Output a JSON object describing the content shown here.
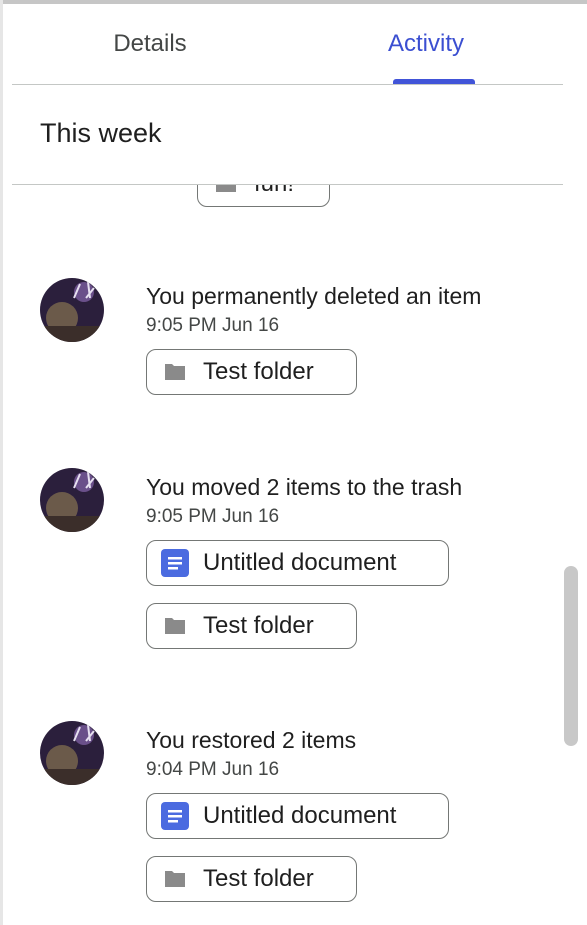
{
  "tabs": [
    {
      "label": "Details",
      "selected": false
    },
    {
      "label": "Activity",
      "selected": true
    }
  ],
  "accent_color": "#3b4fd1",
  "section": {
    "title": "This week"
  },
  "partial_item": {
    "label": "fun!",
    "icon": "folder-icon"
  },
  "entries": [
    {
      "title": "You permanently deleted an item",
      "time": "9:05 PM Jun 16",
      "items": [
        {
          "label": "Test folder",
          "icon": "folder-icon"
        }
      ]
    },
    {
      "title": "You moved 2 items to the trash",
      "time": "9:05 PM Jun 16",
      "items": [
        {
          "label": "Untitled document",
          "icon": "docs-icon"
        },
        {
          "label": "Test folder",
          "icon": "folder-icon"
        }
      ]
    },
    {
      "title": "You restored 2 items",
      "time": "9:04 PM Jun 16",
      "items": [
        {
          "label": "Untitled document",
          "icon": "docs-icon"
        },
        {
          "label": "Test folder",
          "icon": "folder-icon"
        }
      ]
    }
  ]
}
